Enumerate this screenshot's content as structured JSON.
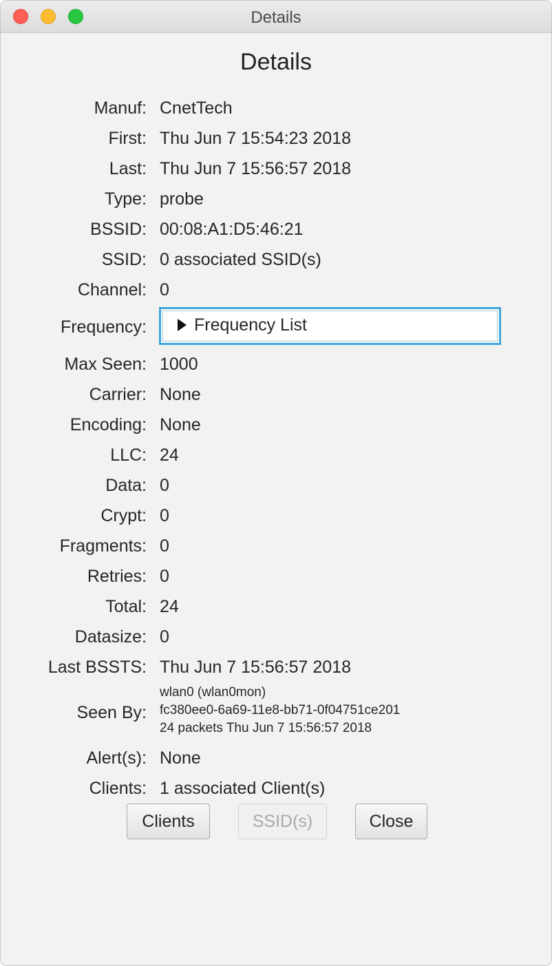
{
  "window": {
    "title": "Details"
  },
  "heading": "Details",
  "fields": [
    {
      "label": "Manuf:",
      "value": "CnetTech"
    },
    {
      "label": "First:",
      "value": "Thu Jun 7 15:54:23 2018"
    },
    {
      "label": "Last:",
      "value": "Thu Jun 7 15:56:57 2018"
    },
    {
      "label": "Type:",
      "value": "probe"
    },
    {
      "label": "BSSID:",
      "value": "00:08:A1:D5:46:21"
    },
    {
      "label": "SSID:",
      "value": "0 associated SSID(s)"
    },
    {
      "label": "Channel:",
      "value": "0"
    }
  ],
  "frequency": {
    "label": "Frequency:",
    "value": "Frequency List"
  },
  "fields2": [
    {
      "label": "Max Seen:",
      "value": "1000"
    },
    {
      "label": "Carrier:",
      "value": "None"
    },
    {
      "label": "Encoding:",
      "value": "None"
    },
    {
      "label": "LLC:",
      "value": "24"
    },
    {
      "label": "Data:",
      "value": "0"
    },
    {
      "label": "Crypt:",
      "value": "0"
    },
    {
      "label": "Fragments:",
      "value": "0"
    },
    {
      "label": "Retries:",
      "value": "0"
    },
    {
      "label": "Total:",
      "value": "24"
    },
    {
      "label": "Datasize:",
      "value": "0"
    },
    {
      "label": "Last BSSTS:",
      "value": "Thu Jun 7 15:56:57 2018"
    }
  ],
  "seen_by": {
    "label": "Seen By:",
    "lines": [
      "wlan0 (wlan0mon)",
      "fc380ee0-6a69-11e8-bb71-0f04751ce201",
      "24 packets Thu Jun 7 15:56:57 2018"
    ]
  },
  "fields3": [
    {
      "label": "Alert(s):",
      "value": "None"
    },
    {
      "label": "Clients:",
      "value": "1 associated Client(s)"
    }
  ],
  "buttons": {
    "clients": "Clients",
    "ssids": "SSID(s)",
    "close": "Close"
  }
}
